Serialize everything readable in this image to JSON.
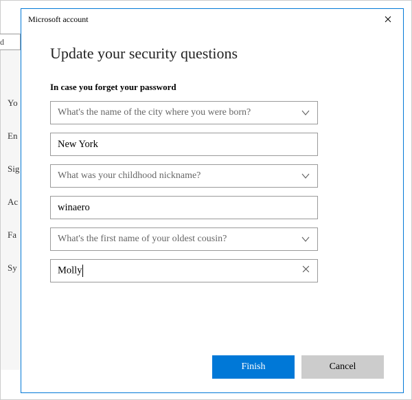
{
  "window": {
    "title": "Microsoft account"
  },
  "page": {
    "heading": "Update your security questions",
    "subheading": "In case you forget your password"
  },
  "background": {
    "truncated_input": "d",
    "labels": [
      "Yo",
      "En",
      "Sig",
      "Ac",
      "Fa",
      "Sy"
    ]
  },
  "form": {
    "q1_select": "What's the name of the city where you were born?",
    "q1_answer": "New York",
    "q2_select": "What was your childhood nickname?",
    "q2_answer": "winaero",
    "q3_select": "What's the first name of your oldest cousin?",
    "q3_answer": "Molly"
  },
  "buttons": {
    "finish": "Finish",
    "cancel": "Cancel"
  }
}
